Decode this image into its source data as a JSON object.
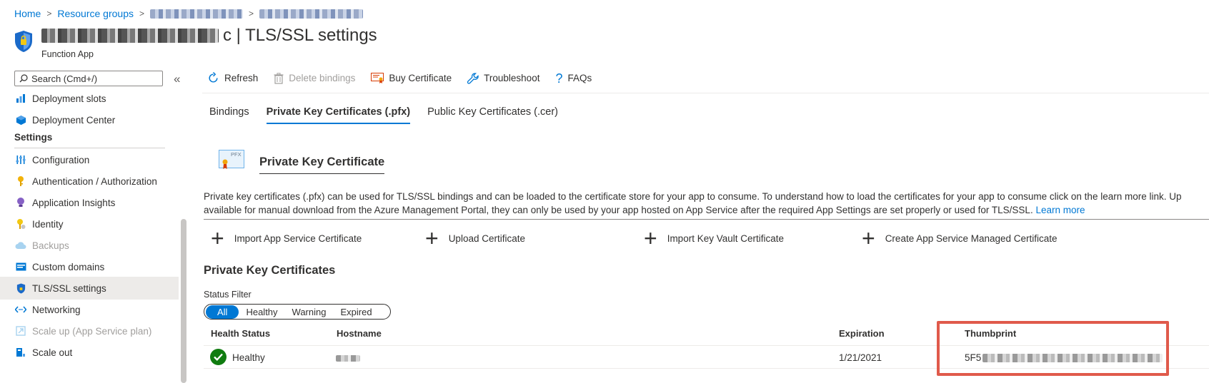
{
  "breadcrumb": {
    "home": "Home",
    "resource_groups": "Resource groups"
  },
  "header": {
    "title_suffix": "c | TLS/SSL settings",
    "subtitle": "Function App"
  },
  "sidebar": {
    "search_placeholder": "Search (Cmd+/)",
    "collapse_glyph": "«",
    "items_top": [
      {
        "label": "Deployment slots",
        "icon": "deployment-slots-icon"
      },
      {
        "label": "Deployment Center",
        "icon": "deployment-center-icon"
      }
    ],
    "settings_heading": "Settings",
    "items": [
      {
        "label": "Configuration",
        "icon": "configuration-icon"
      },
      {
        "label": "Authentication / Authorization",
        "icon": "key-icon"
      },
      {
        "label": "Application Insights",
        "icon": "lightbulb-icon"
      },
      {
        "label": "Identity",
        "icon": "identity-icon"
      },
      {
        "label": "Backups",
        "icon": "cloud-icon",
        "disabled": true
      },
      {
        "label": "Custom domains",
        "icon": "custom-domains-icon"
      },
      {
        "label": "TLS/SSL settings",
        "icon": "shield-icon",
        "selected": true
      },
      {
        "label": "Networking",
        "icon": "networking-icon"
      },
      {
        "label": "Scale up (App Service plan)",
        "icon": "scale-up-icon",
        "disabled": true
      },
      {
        "label": "Scale out",
        "icon": "scale-out-icon"
      }
    ]
  },
  "toolbar": {
    "refresh": "Refresh",
    "delete_bindings": "Delete bindings",
    "buy_certificate": "Buy Certificate",
    "troubleshoot": "Troubleshoot",
    "faqs": "FAQs"
  },
  "tabs": [
    "Bindings",
    "Private Key Certificates (.pfx)",
    "Public Key Certificates (.cer)"
  ],
  "certificate": {
    "icon_label": "PFX",
    "title": "Private Key Certificate",
    "description_line1": "Private key certificates (.pfx) can be used for TLS/SSL bindings and can be loaded to the certificate store for your app to consume. To understand how to load the certificates for your app to consume click on the learn more link. Up",
    "description_line2": "available for manual download from the Azure Management Portal, they can only be used by your app hosted on App Service after the required App Settings are set properly or used for TLS/SSL.",
    "learn_more": "Learn more",
    "actions": [
      "Import App Service Certificate",
      "Upload Certificate",
      "Import Key Vault Certificate",
      "Create App Service Managed Certificate"
    ]
  },
  "private_key_certs": {
    "heading": "Private Key Certificates",
    "filter_label": "Status Filter",
    "filters": [
      "All",
      "Healthy",
      "Warning",
      "Expired"
    ],
    "selected_filter": "All",
    "columns": [
      "Health Status",
      "Hostname",
      "Expiration",
      "Thumbprint"
    ],
    "rows": [
      {
        "status": "Healthy",
        "expiration": "1/21/2021",
        "thumbprint_prefix": "5F5"
      }
    ]
  },
  "colors": {
    "accent": "#0078d4",
    "healthy": "#107c10",
    "highlight": "#e05a4b"
  }
}
